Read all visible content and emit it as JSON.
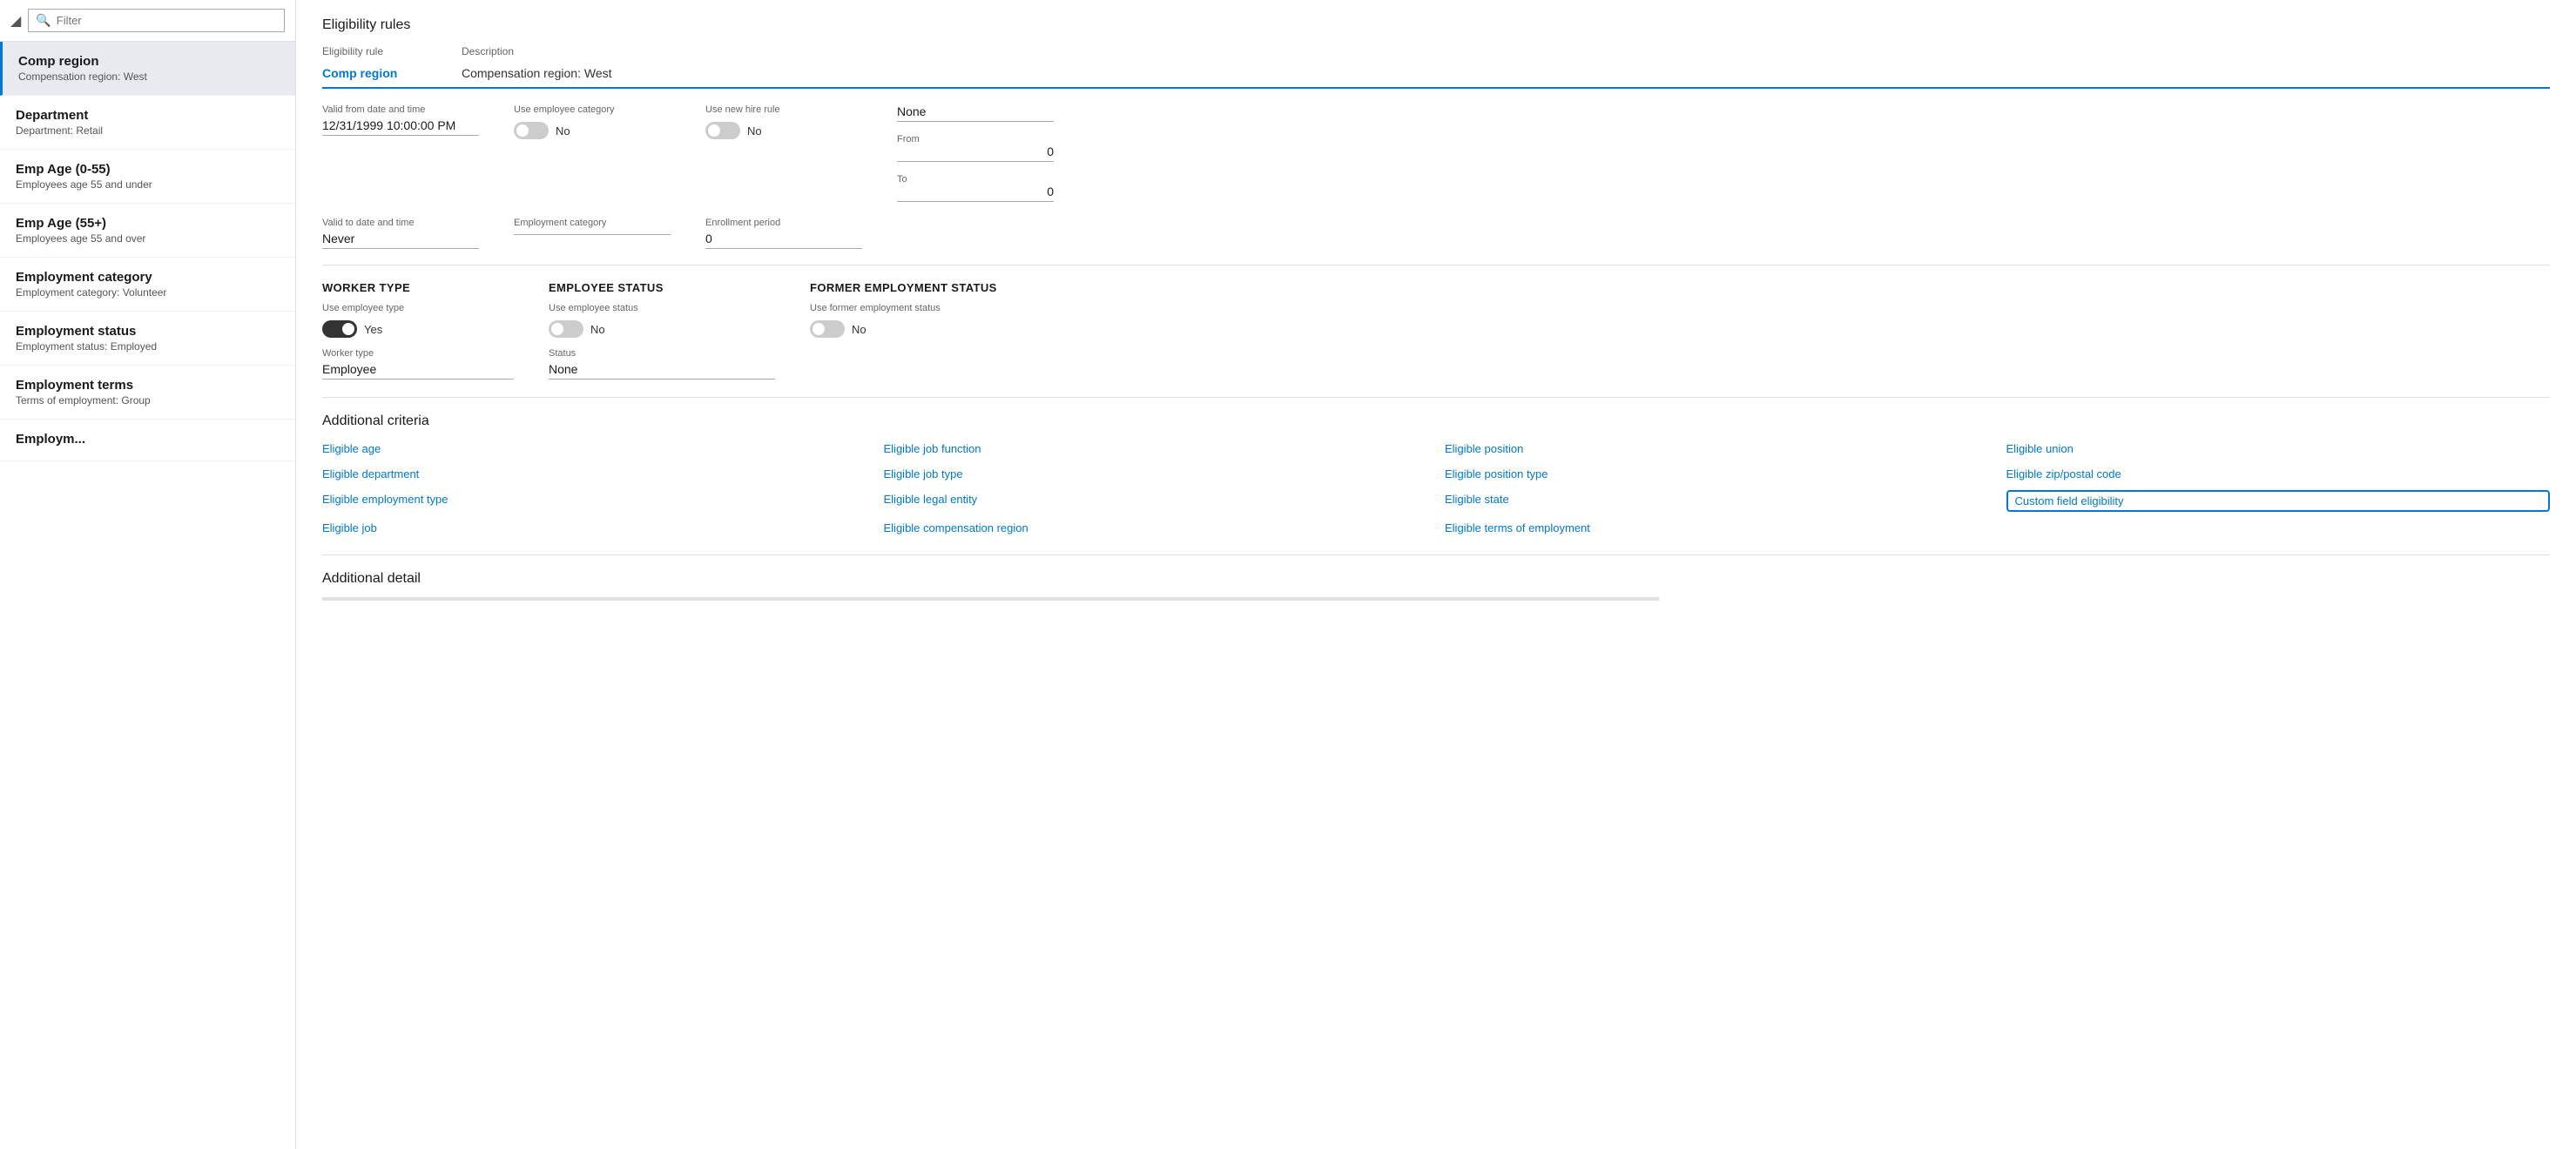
{
  "sidebar": {
    "search_placeholder": "Filter",
    "items": [
      {
        "title": "Comp region",
        "sub": "Compensation region:  West",
        "active": true
      },
      {
        "title": "Department",
        "sub": "Department:  Retail",
        "active": false
      },
      {
        "title": "Emp Age (0-55)",
        "sub": "Employees age 55 and under",
        "active": false
      },
      {
        "title": "Emp Age (55+)",
        "sub": "Employees age 55 and over",
        "active": false
      },
      {
        "title": "Employment category",
        "sub": "Employment category:  Volunteer",
        "active": false
      },
      {
        "title": "Employment status",
        "sub": "Employment status:  Employed",
        "active": false
      },
      {
        "title": "Employment terms",
        "sub": "Terms of employment:  Group",
        "active": false
      },
      {
        "title": "Employm...",
        "sub": "",
        "active": false
      }
    ]
  },
  "header": {
    "page_title": "Eligibility rules",
    "tab_col1": "Eligibility rule",
    "tab_col2": "Description",
    "tab_active": "Comp region",
    "tab_description": "Compensation region:  West"
  },
  "form": {
    "valid_from_label": "Valid from date and time",
    "valid_from_value": "12/31/1999 10:00:00 PM",
    "use_employee_category_label": "Use employee category",
    "use_employee_category_value": "No",
    "use_employee_category_checked": false,
    "use_new_hire_rule_label": "Use new hire rule",
    "use_new_hire_rule_value": "No",
    "use_new_hire_rule_checked": false,
    "none_label": "None",
    "from_label": "From",
    "from_value": "0",
    "to_label": "To",
    "to_value": "0",
    "valid_to_label": "Valid to date and time",
    "valid_to_value": "Never",
    "employment_category_label": "Employment category",
    "employment_category_value": "",
    "enrollment_period_label": "Enrollment period",
    "enrollment_period_value": "0",
    "worker_type_section": "WORKER TYPE",
    "use_employee_type_label": "Use employee type",
    "use_employee_type_checked": true,
    "use_employee_type_value": "Yes",
    "worker_type_label": "Worker type",
    "worker_type_value": "Employee",
    "employee_status_section": "EMPLOYEE STATUS",
    "use_employee_status_label": "Use employee status",
    "use_employee_status_checked": false,
    "use_employee_status_value": "No",
    "status_label": "Status",
    "status_value": "None",
    "former_employment_section": "FORMER EMPLOYMENT STATUS",
    "use_former_employment_label": "Use former employment status",
    "use_former_employment_checked": false,
    "use_former_employment_value": "No"
  },
  "additional_criteria": {
    "title": "Additional criteria",
    "links": [
      "Eligible age",
      "Eligible job function",
      "Eligible position",
      "Eligible union",
      "Eligible department",
      "Eligible job type",
      "Eligible position type",
      "Eligible zip/postal code",
      "Eligible employment type",
      "Eligible legal entity",
      "Eligible state",
      "Custom field eligibility",
      "Eligible job",
      "Eligible compensation region",
      "Eligible terms of employment",
      ""
    ]
  },
  "additional_detail": {
    "title": "Additional detail"
  }
}
